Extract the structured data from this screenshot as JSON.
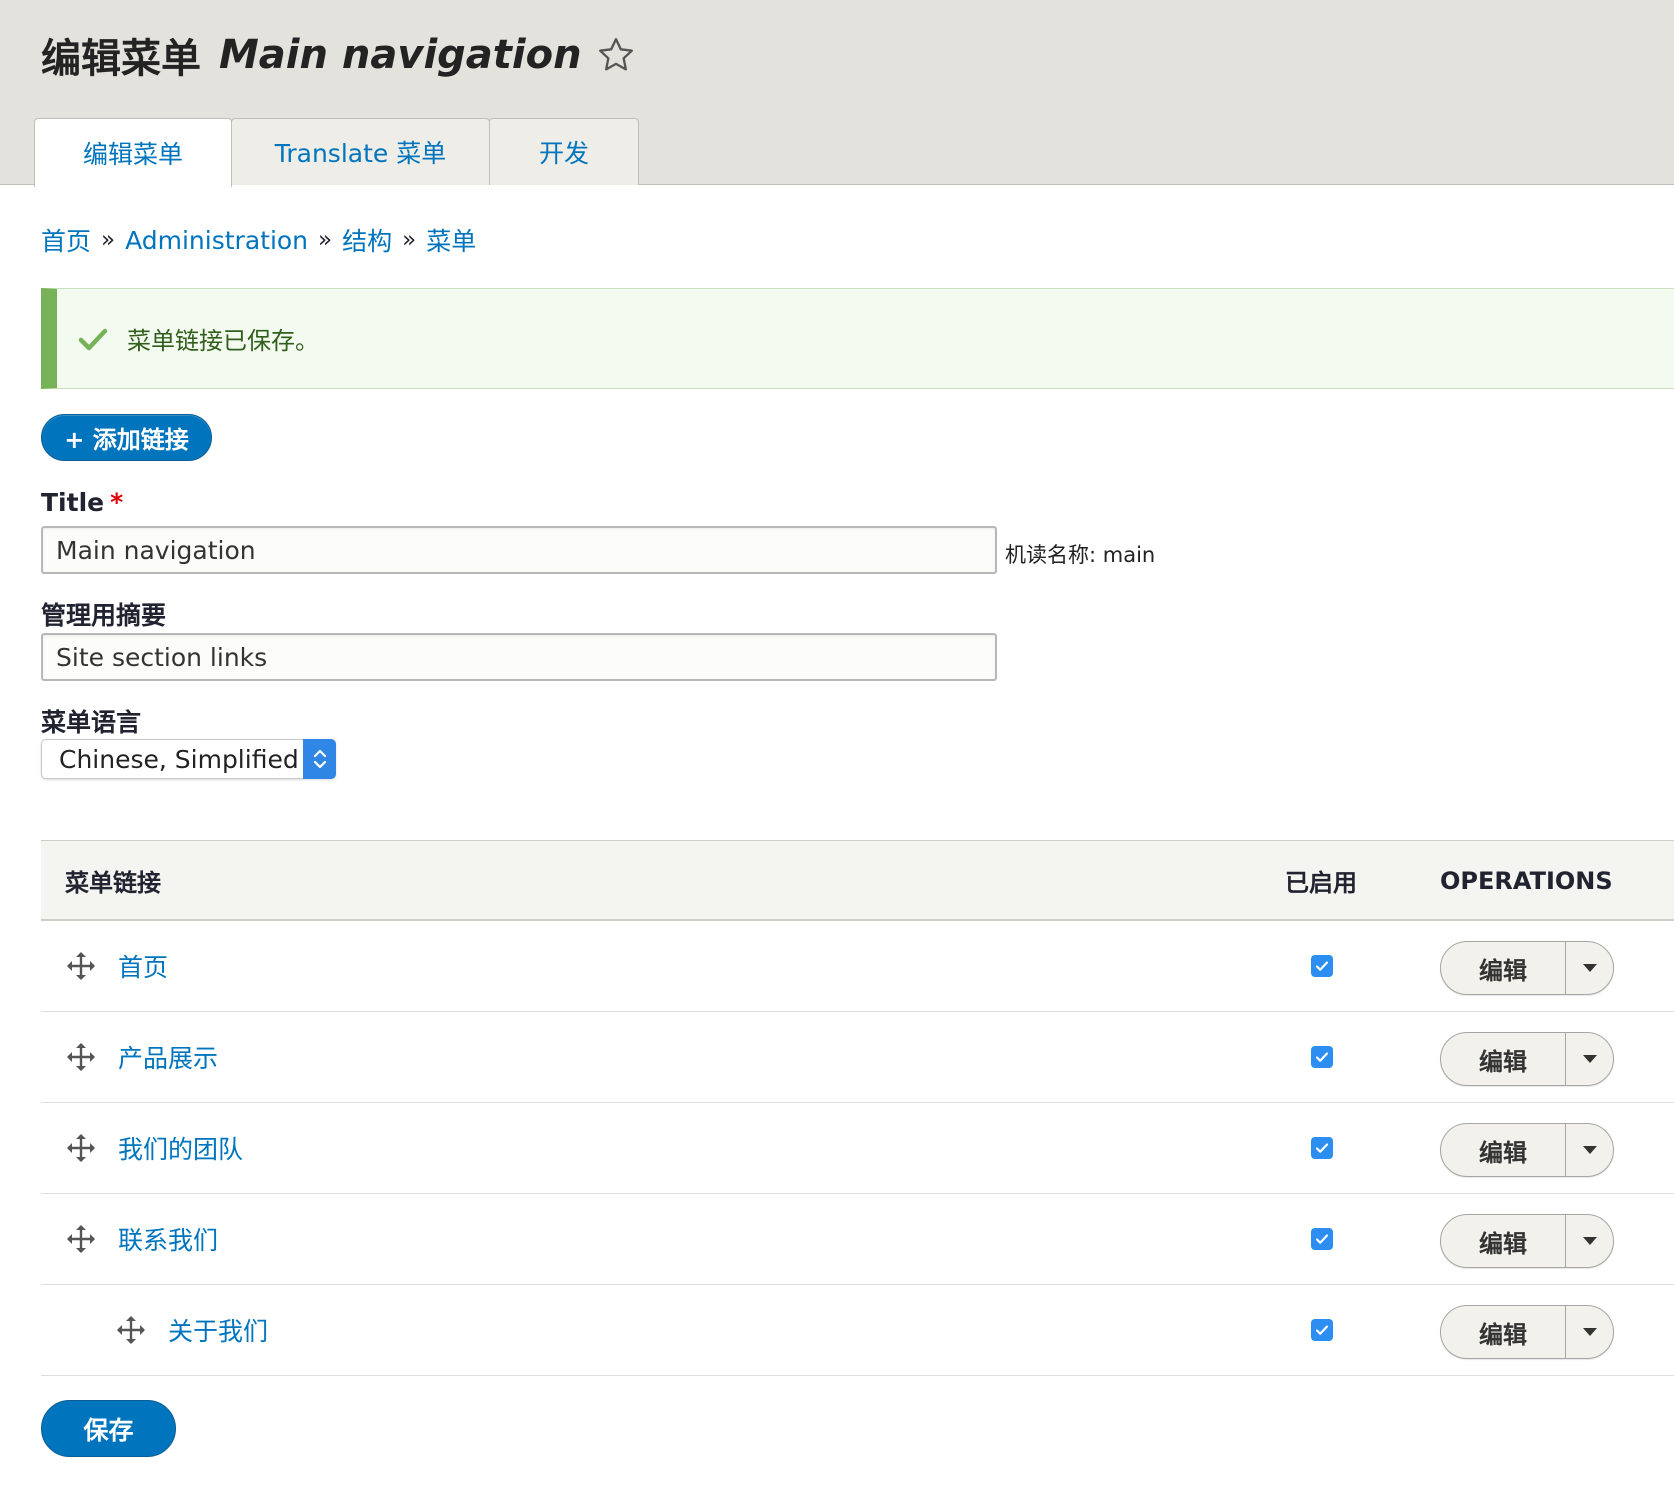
{
  "header": {
    "title_prefix": "编辑菜单",
    "title_name": "Main navigation",
    "star_icon": "star-outline-icon"
  },
  "tabs": [
    {
      "label": "编辑菜单",
      "active": true
    },
    {
      "label": "Translate 菜单",
      "active": false
    },
    {
      "label": "开发",
      "active": false
    }
  ],
  "breadcrumb": {
    "items": [
      "首页",
      "Administration",
      "结构",
      "菜单"
    ],
    "separator": "»"
  },
  "status": {
    "message": "菜单链接已保存。",
    "icon": "check-icon"
  },
  "add_link_button": "+ 添加链接",
  "form": {
    "title_label": "Title",
    "title_required_mark": "*",
    "title_value": "Main navigation",
    "machine_name": "机读名称: main",
    "summary_label": "管理用摘要",
    "summary_value": "Site section links",
    "language_label": "菜单语言",
    "language_value": "Chinese, Simplified"
  },
  "table": {
    "headers": {
      "link": "菜单链接",
      "enabled": "已启用",
      "operations": "OPERATIONS"
    },
    "rows": [
      {
        "label": "首页",
        "enabled": true,
        "edit": "编辑",
        "indent": 0
      },
      {
        "label": "产品展示",
        "enabled": true,
        "edit": "编辑",
        "indent": 0
      },
      {
        "label": "我们的团队",
        "enabled": true,
        "edit": "编辑",
        "indent": 0
      },
      {
        "label": "联系我们",
        "enabled": true,
        "edit": "编辑",
        "indent": 0
      },
      {
        "label": "关于我们",
        "enabled": true,
        "edit": "编辑",
        "indent": 1
      }
    ]
  },
  "save_button": "保存",
  "colors": {
    "link": "#0074bd",
    "primary_button": "#0074bd",
    "status_accent": "#77b259",
    "header_bg": "#e4e2dc",
    "checkbox": "#2b8ef0"
  }
}
